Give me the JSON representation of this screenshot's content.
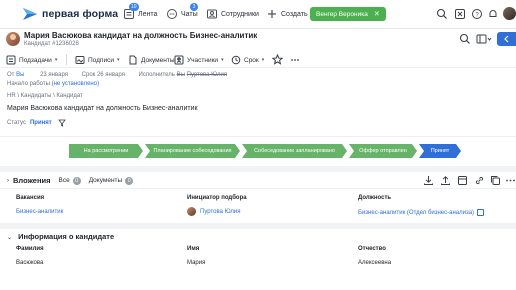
{
  "topbar": {
    "brand": "первая форма",
    "nav": [
      {
        "label": "Лента",
        "badge": "10",
        "icon": "feed-icon"
      },
      {
        "label": "Чаты",
        "badge": "3",
        "icon": "chat-icon"
      },
      {
        "label": "Сотрудники",
        "icon": "people-icon"
      },
      {
        "label": "Создать",
        "icon": "plus-icon"
      }
    ],
    "user": "Венгер Вероника",
    "user_close": "✕",
    "colors": {
      "accent": "#4caf50",
      "link": "#2f6fd6",
      "badge": "#3b82f6"
    }
  },
  "header": {
    "title": "Мария Васюкова кандидат на должность Бизнес-аналитик",
    "subtitle": "Кандидат  #1236028"
  },
  "toolbar": {
    "items": [
      {
        "label": "Подзадачи",
        "icon": "subtasks-icon"
      },
      {
        "label": "Подписи",
        "icon": "signature-icon"
      },
      {
        "label": "Документы",
        "icon": "documents-icon"
      },
      {
        "label": "Участники",
        "icon": "participants-icon"
      },
      {
        "label": "Срок",
        "icon": "clock-icon"
      }
    ]
  },
  "info": {
    "from_label": "От",
    "from_value": "Вы",
    "date": "23 января",
    "deadline_label": "Срок",
    "deadline_value": "26 января",
    "executor_label": "Исполнитель",
    "executor_value": "Вы",
    "executor_old": "Пуртова Юлия",
    "start_label": "Начало работы",
    "start_value": "(не установлено)",
    "breadcrumb": "HR \\ Кандидаты \\ Кандидат",
    "description": "Мария Васюкова кандидат на должность Бизнес-аналитик",
    "status_label": "Статус",
    "status_value": "Принят"
  },
  "pipeline": {
    "stages": [
      "На рассмотрении",
      "Планирование собеседования",
      "Собеседование запланировано",
      "Оффер отправлен",
      "Принят"
    ],
    "current": 4
  },
  "attachments": {
    "title": "Вложения",
    "tabs": [
      {
        "label": "Все",
        "count": "0"
      },
      {
        "label": "Документы",
        "count": "0"
      }
    ]
  },
  "fields": {
    "headers": [
      "Вакансия",
      "Инициатор подбора",
      "Должность"
    ],
    "values": [
      "Бизнес-аналитик",
      "Пуртова Юлия",
      "Бизнес-аналитик (Отдел бизнес-анализа)"
    ]
  },
  "candidate_info": {
    "title": "Информация о кандидате",
    "headers": [
      "Фамилия",
      "Имя",
      "Отчество"
    ],
    "values": [
      "Васюкова",
      "Мария",
      "Алексеевна"
    ]
  }
}
